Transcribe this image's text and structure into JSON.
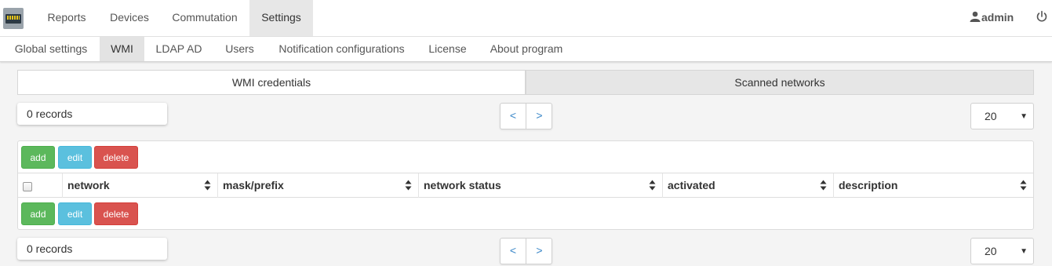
{
  "topnav": {
    "items": [
      {
        "label": "Reports",
        "active": false
      },
      {
        "label": "Devices",
        "active": false
      },
      {
        "label": "Commutation",
        "active": false
      },
      {
        "label": "Settings",
        "active": true
      }
    ],
    "user": "admin"
  },
  "subnav": {
    "items": [
      {
        "label": "Global settings",
        "active": false
      },
      {
        "label": "WMI",
        "active": true
      },
      {
        "label": "LDAP AD",
        "active": false
      },
      {
        "label": "Users",
        "active": false
      },
      {
        "label": "Notification configurations",
        "active": false
      },
      {
        "label": "License",
        "active": false
      },
      {
        "label": "About program",
        "active": false
      }
    ]
  },
  "tabs": [
    {
      "label": "WMI credentials",
      "active": true
    },
    {
      "label": "Scanned networks",
      "active": false
    }
  ],
  "records_top": "0 records",
  "records_bottom": "0 records",
  "pager": {
    "prev": "<",
    "next": ">"
  },
  "page_size": "20",
  "buttons": {
    "add": "add",
    "edit": "edit",
    "delete": "delete"
  },
  "table": {
    "columns": [
      "network",
      "mask/prefix",
      "network status",
      "activated",
      "description"
    ]
  },
  "colors": {
    "add": "#5cb85c",
    "edit": "#5bc0de",
    "delete": "#d9534f",
    "link": "#3a87c8"
  }
}
